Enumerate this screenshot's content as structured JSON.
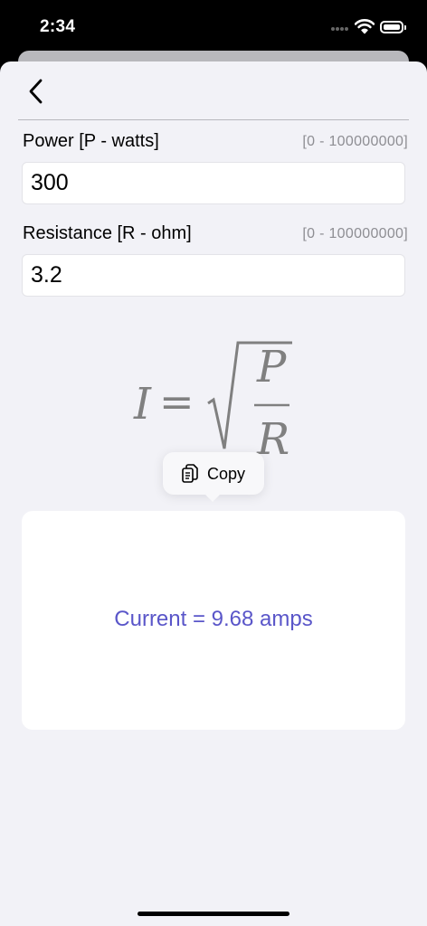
{
  "status_bar": {
    "time": "2:34",
    "icons": [
      "cellular-dots-icon",
      "wifi-icon",
      "battery-icon"
    ]
  },
  "nav": {
    "back_icon": "chevron-left-icon"
  },
  "fields": {
    "power": {
      "label": "Power [P - watts]",
      "range": "[0 - 100000000]",
      "value": "300"
    },
    "resistance": {
      "label": "Resistance [R - ohm]",
      "range": "[0 - 100000000]",
      "value": "3.2"
    }
  },
  "formula": {
    "lhs": "I",
    "equals": "=",
    "numerator": "P",
    "denominator": "R"
  },
  "copy_popup": {
    "label": "Copy",
    "icon": "copy-docs-icon"
  },
  "result": {
    "text": "Current = 9.68 amps"
  },
  "colors": {
    "accent": "#5a56c9",
    "background": "#f2f2f7",
    "card": "#ffffff",
    "secondary_text": "#8e8e93",
    "formula": "#808080"
  }
}
